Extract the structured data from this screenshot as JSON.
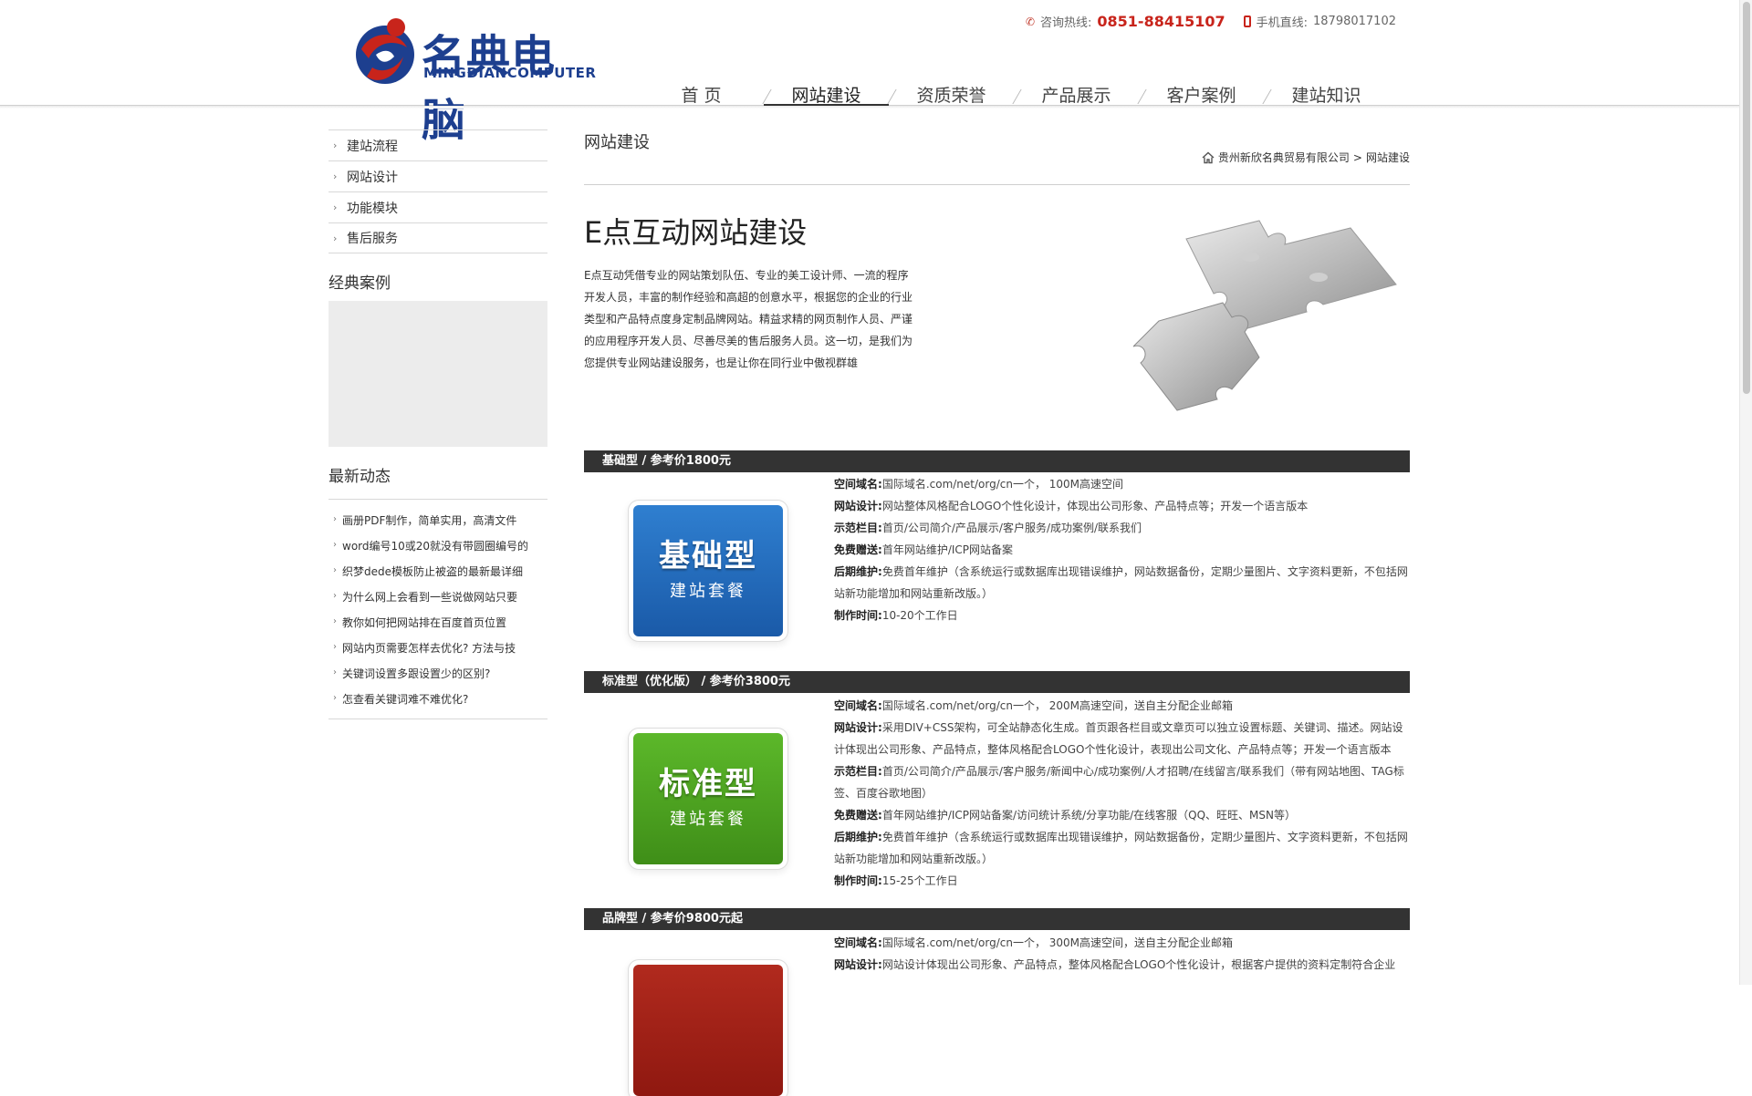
{
  "header": {
    "logo_cn": "名典电脑",
    "logo_en": "MINGDIANCOMPUTER",
    "hotline_label": "咨询热线:",
    "hotline_number": "0851-88415107",
    "mobile_label": "手机直线:",
    "mobile_number": "18798017102",
    "nav": [
      "首 页",
      "网站建设",
      "资质荣誉",
      "产品展示",
      "客户案例",
      "建站知识"
    ],
    "nav_active": "网站建设"
  },
  "sidebar": {
    "menu": [
      "建站流程",
      "网站设计",
      "功能模块",
      "售后服务"
    ],
    "cases_heading": "经典案例",
    "news_heading": "最新动态",
    "news": [
      "画册PDF制作，简单实用，高清文件",
      "word编号10或20就没有带圆圈编号的",
      "织梦dede模板防止被盗的最新最详细",
      "为什么网上会看到一些说做网站只要",
      "教你如何把网站排在百度首页位置",
      "网站内页需要怎样去优化? 方法与技",
      "关键词设置多跟设置少的区别?",
      "怎查看关键词难不难优化?"
    ]
  },
  "main": {
    "page_title": "网站建设",
    "breadcrumb": {
      "home": "贵州新欣名典贸易有限公司",
      "sep": ">",
      "current": "网站建设"
    },
    "intro_title": "E点互动网站建设",
    "intro_text": "E点互动凭借专业的网站策划队伍、专业的美工设计师、一流的程序开发人员，丰富的制作经验和高超的创意水平，根据您的企业的行业类型和产品特点度身定制品牌网站。精益求精的网页制作人员、严谨的应用程序开发人员、尽善尽美的售后服务人员。这一切，是我们为您提供专业网站建设服务，也是让你在同行业中傲视群雄",
    "packages": [
      {
        "bar": "基础型 / 参考价1800元",
        "badge_main": "基础型",
        "badge_sub": "建站套餐",
        "color": "#1a63b5",
        "rows": [
          {
            "k": "空间域名:",
            "v": "国际域名.com/net/org/cn一个， 100M高速空间"
          },
          {
            "k": "网站设计:",
            "v": "网站整体风格配合LOGO个性化设计，体现出公司形象、产品特点等；开发一个语言版本"
          },
          {
            "k": "示范栏目:",
            "v": "首页/公司简介/产品展示/客户服务/成功案例/联系我们"
          },
          {
            "k": "免费赠送:",
            "v": "首年网站维护/ICP网站备案"
          },
          {
            "k": "后期维护:",
            "v": "免费首年维护（含系统运行或数据库出现错误维护，网站数据备份，定期少量图片、文字资料更新，不包括网站新功能增加和网站重新改版。）"
          },
          {
            "k": "制作时间:",
            "v": "10-20个工作日"
          }
        ]
      },
      {
        "bar": "标准型（优化版） / 参考价3800元",
        "badge_main": "标准型",
        "badge_sub": "建站套餐",
        "color": "#4a9a1c",
        "rows": [
          {
            "k": "空间域名:",
            "v": "国际域名.com/net/org/cn一个， 200M高速空间，送自主分配企业邮箱"
          },
          {
            "k": "网站设计:",
            "v": "采用DIV+CSS架构，可全站静态化生成。首页跟各栏目或文章页可以独立设置标题、关键词、描述。网站设计体现出公司形象、产品特点，整体风格配合LOGO个性化设计，表现出公司文化、产品特点等；开发一个语言版本"
          },
          {
            "k": "示范栏目:",
            "v": "首页/公司简介/产品展示/客户服务/新闻中心/成功案例/人才招聘/在线留言/联系我们（带有网站地图、TAG标签、百度谷歌地图）"
          },
          {
            "k": "免费赠送:",
            "v": "首年网站维护/ICP网站备案/访问统计系统/分享功能/在线客服（QQ、旺旺、MSN等）"
          },
          {
            "k": "后期维护:",
            "v": "免费首年维护（含系统运行或数据库出现错误维护，网站数据备份，定期少量图片、文字资料更新，不包括网站新功能增加和网站重新改版。）"
          },
          {
            "k": "制作时间:",
            "v": "15-25个工作日"
          }
        ]
      },
      {
        "bar": "品牌型 / 参考价9800元起",
        "badge_main": "",
        "badge_sub": "",
        "color": "#9e1b12",
        "rows": [
          {
            "k": "空间域名:",
            "v": "国际域名.com/net/org/cn一个， 300M高速空间，送自主分配企业邮箱"
          },
          {
            "k": "网站设计:",
            "v": "网站设计体现出公司形象、产品特点，整体风格配合LOGO个性化设计，根据客户提供的资料定制符合企业"
          }
        ]
      }
    ]
  },
  "colors": {
    "brand_blue": "#1d3f8f",
    "brand_red": "#c8241b",
    "bar_dark": "#333333"
  }
}
